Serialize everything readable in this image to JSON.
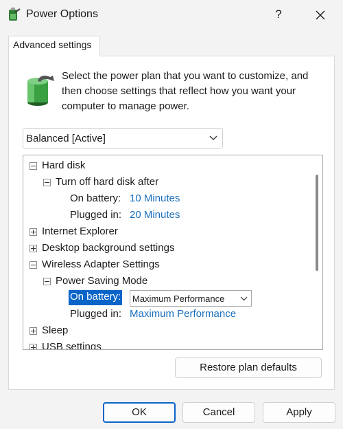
{
  "window": {
    "title": "Power Options",
    "help_glyph": "?",
    "icon": "power-options-icon"
  },
  "tab": {
    "label": "Advanced settings"
  },
  "description": "Select the power plan that you want to customize, and then choose settings that reflect how you want your computer to manage power.",
  "plan": {
    "selected": "Balanced [Active]"
  },
  "tree": {
    "hard_disk": "Hard disk",
    "turn_off_hard_disk": "Turn off hard disk after",
    "hd_on_battery_label": "On battery:",
    "hd_on_battery_value": "10 Minutes",
    "hd_plugged_label": "Plugged in:",
    "hd_plugged_value": "20 Minutes",
    "internet_explorer": "Internet Explorer",
    "desktop_background": "Desktop background settings",
    "wireless_adapter": "Wireless Adapter Settings",
    "power_saving_mode": "Power Saving Mode",
    "ps_on_battery_label": "On battery:",
    "ps_on_battery_value": "Maximum Performance",
    "ps_plugged_label": "Plugged in:",
    "ps_plugged_value": "Maximum Performance",
    "sleep": "Sleep",
    "usb_settings": "USB settings"
  },
  "buttons": {
    "restore": "Restore plan defaults",
    "ok": "OK",
    "cancel": "Cancel",
    "apply": "Apply"
  },
  "colors": {
    "accent": "#0a64c8",
    "link": "#1a6ebd",
    "background": "#f3f3f3"
  }
}
